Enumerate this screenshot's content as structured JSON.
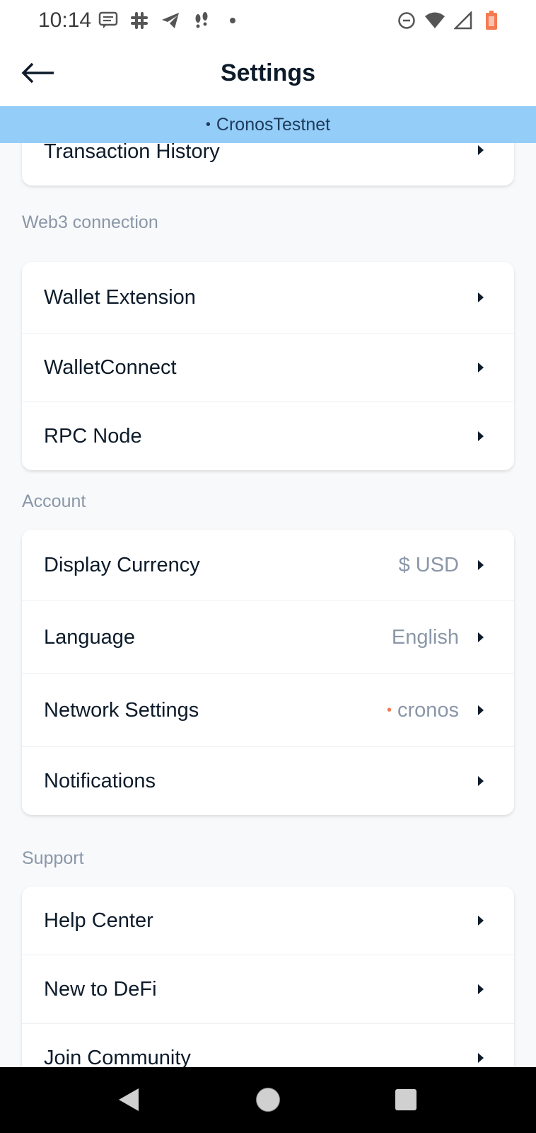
{
  "status_bar": {
    "time": "10:14",
    "left_icons": [
      "message-icon",
      "slack-icon",
      "telegram-icon",
      "feet-icon",
      "dot-icon"
    ],
    "right_icons": [
      "do-not-disturb-icon",
      "wifi-icon",
      "signal-icon",
      "battery-icon"
    ]
  },
  "header": {
    "title": "Settings",
    "back_icon": "arrow-left-icon"
  },
  "network_banner": {
    "dot": "•",
    "text": "CronosTestnet",
    "color": "#93cdf8"
  },
  "sections": {
    "top": {
      "items": [
        {
          "label": "Transaction History"
        }
      ]
    },
    "web3": {
      "title": "Web3 connection",
      "items": [
        {
          "label": "Wallet Extension"
        },
        {
          "label": "WalletConnect"
        },
        {
          "label": "RPC Node"
        }
      ]
    },
    "account": {
      "title": "Account",
      "items": [
        {
          "label": "Display Currency",
          "value": "$ USD"
        },
        {
          "label": "Language",
          "value": "English"
        },
        {
          "label": "Network Settings",
          "value": "cronos",
          "dot": "•"
        },
        {
          "label": "Notifications"
        }
      ]
    },
    "support": {
      "title": "Support",
      "items": [
        {
          "label": "Help Center"
        },
        {
          "label": "New to DeFi"
        },
        {
          "label": "Join Community"
        }
      ]
    }
  },
  "nav_bar": {
    "back": "nav-back-icon",
    "home": "nav-home-icon",
    "recents": "nav-recents-icon"
  },
  "colors": {
    "accent_orange": "#f47a52",
    "muted_text": "#8a97a8",
    "banner": "#93cdf8"
  }
}
